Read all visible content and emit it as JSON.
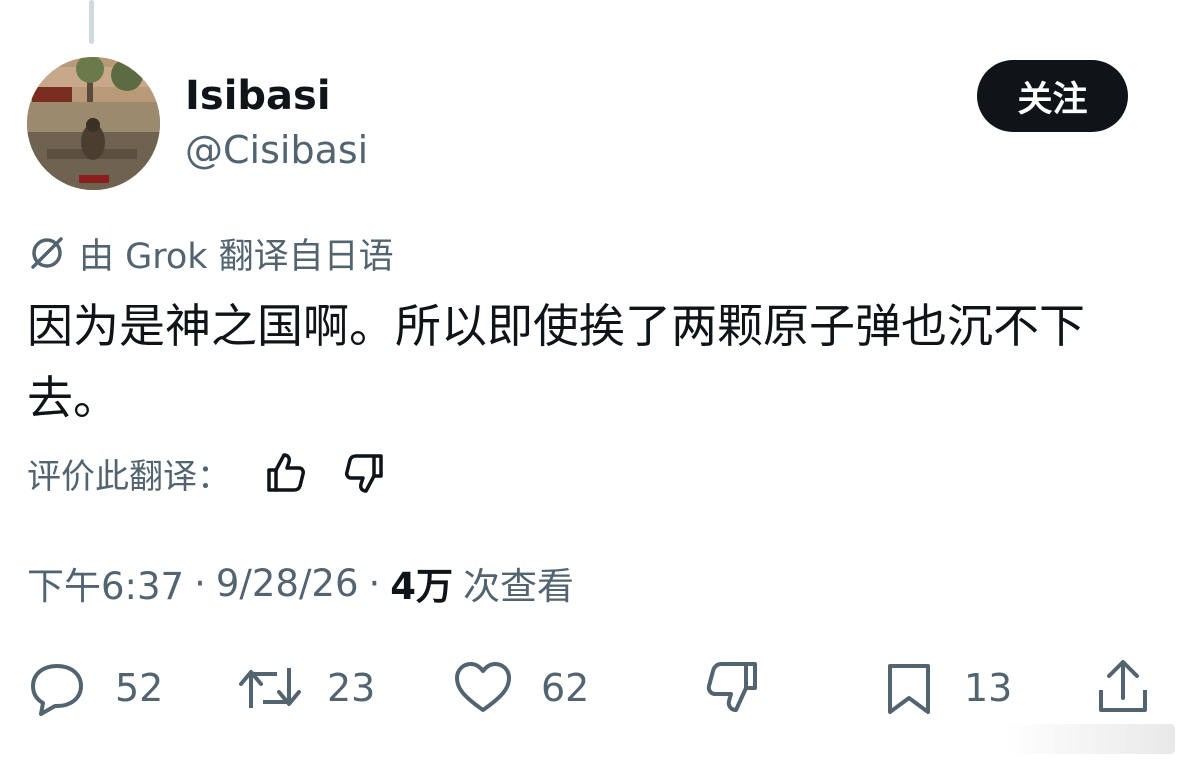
{
  "author": {
    "display_name": "Isibasi",
    "handle": "@Cisibasi",
    "follow_label": "关注"
  },
  "translation_notice": "由 Grok 翻译自日语",
  "tweet": {
    "text": "因为是神之国啊。所以即使挨了两颗原子弹也沉不下去。"
  },
  "rate_translation": {
    "label": "评价此翻译："
  },
  "meta": {
    "time": "下午6:37",
    "dot1": "·",
    "date": "9/28/26",
    "dot2": "·",
    "views_count": "4万",
    "views_label": "次查看"
  },
  "actions": {
    "replies": "52",
    "reposts": "23",
    "likes": "62",
    "bookmarks": "13"
  },
  "icons": {
    "translation": "grok-icon",
    "reply": "reply-icon",
    "repost": "repost-icon",
    "like": "heart-icon",
    "dislike": "thumbs-down-icon",
    "bookmark": "bookmark-icon",
    "share": "share-icon"
  },
  "colors": {
    "text_primary": "#0f1419",
    "text_secondary": "#536471",
    "follow_bg": "#0f1419",
    "follow_text": "#ffffff"
  }
}
